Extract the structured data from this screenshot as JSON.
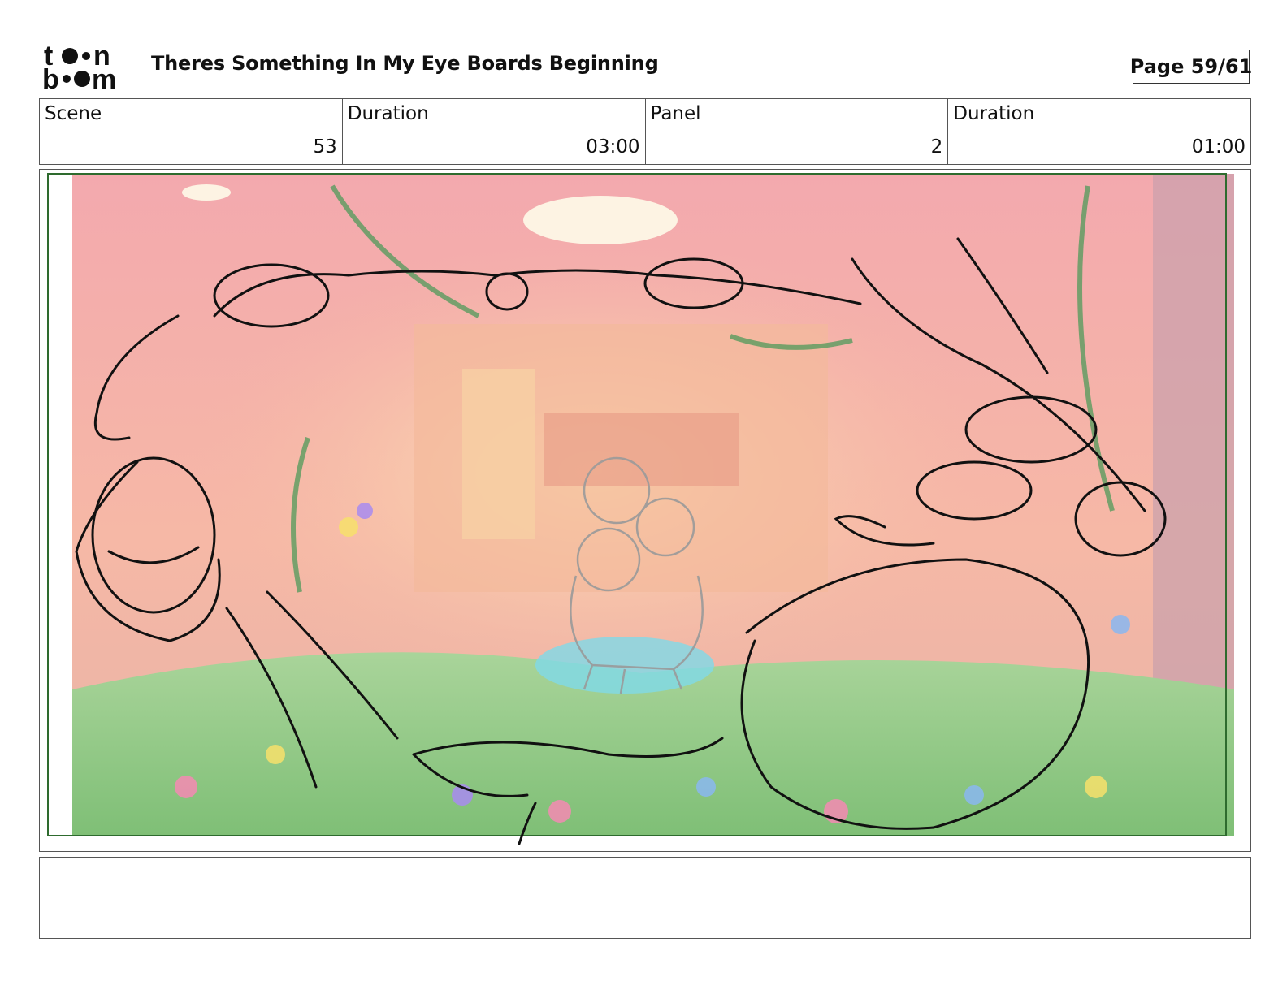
{
  "header": {
    "logo_line1": "toon",
    "logo_line2": "boom",
    "title": "Theres Something In My Eye Boards Beginning",
    "page": "Page 59/61"
  },
  "info": {
    "scene_label": "Scene",
    "scene_value": "53",
    "scene_duration_label": "Duration",
    "scene_duration_value": "03:00",
    "panel_label": "Panel",
    "panel_value": "2",
    "panel_duration_label": "Duration",
    "panel_duration_value": "01:00"
  },
  "panel": {
    "image_icon": "storyboard-frame-image",
    "description": ""
  },
  "notes": {
    "text": ""
  },
  "colors": {
    "frame_border": "#2e6b2e",
    "background_tint": "#f2a0a8"
  }
}
